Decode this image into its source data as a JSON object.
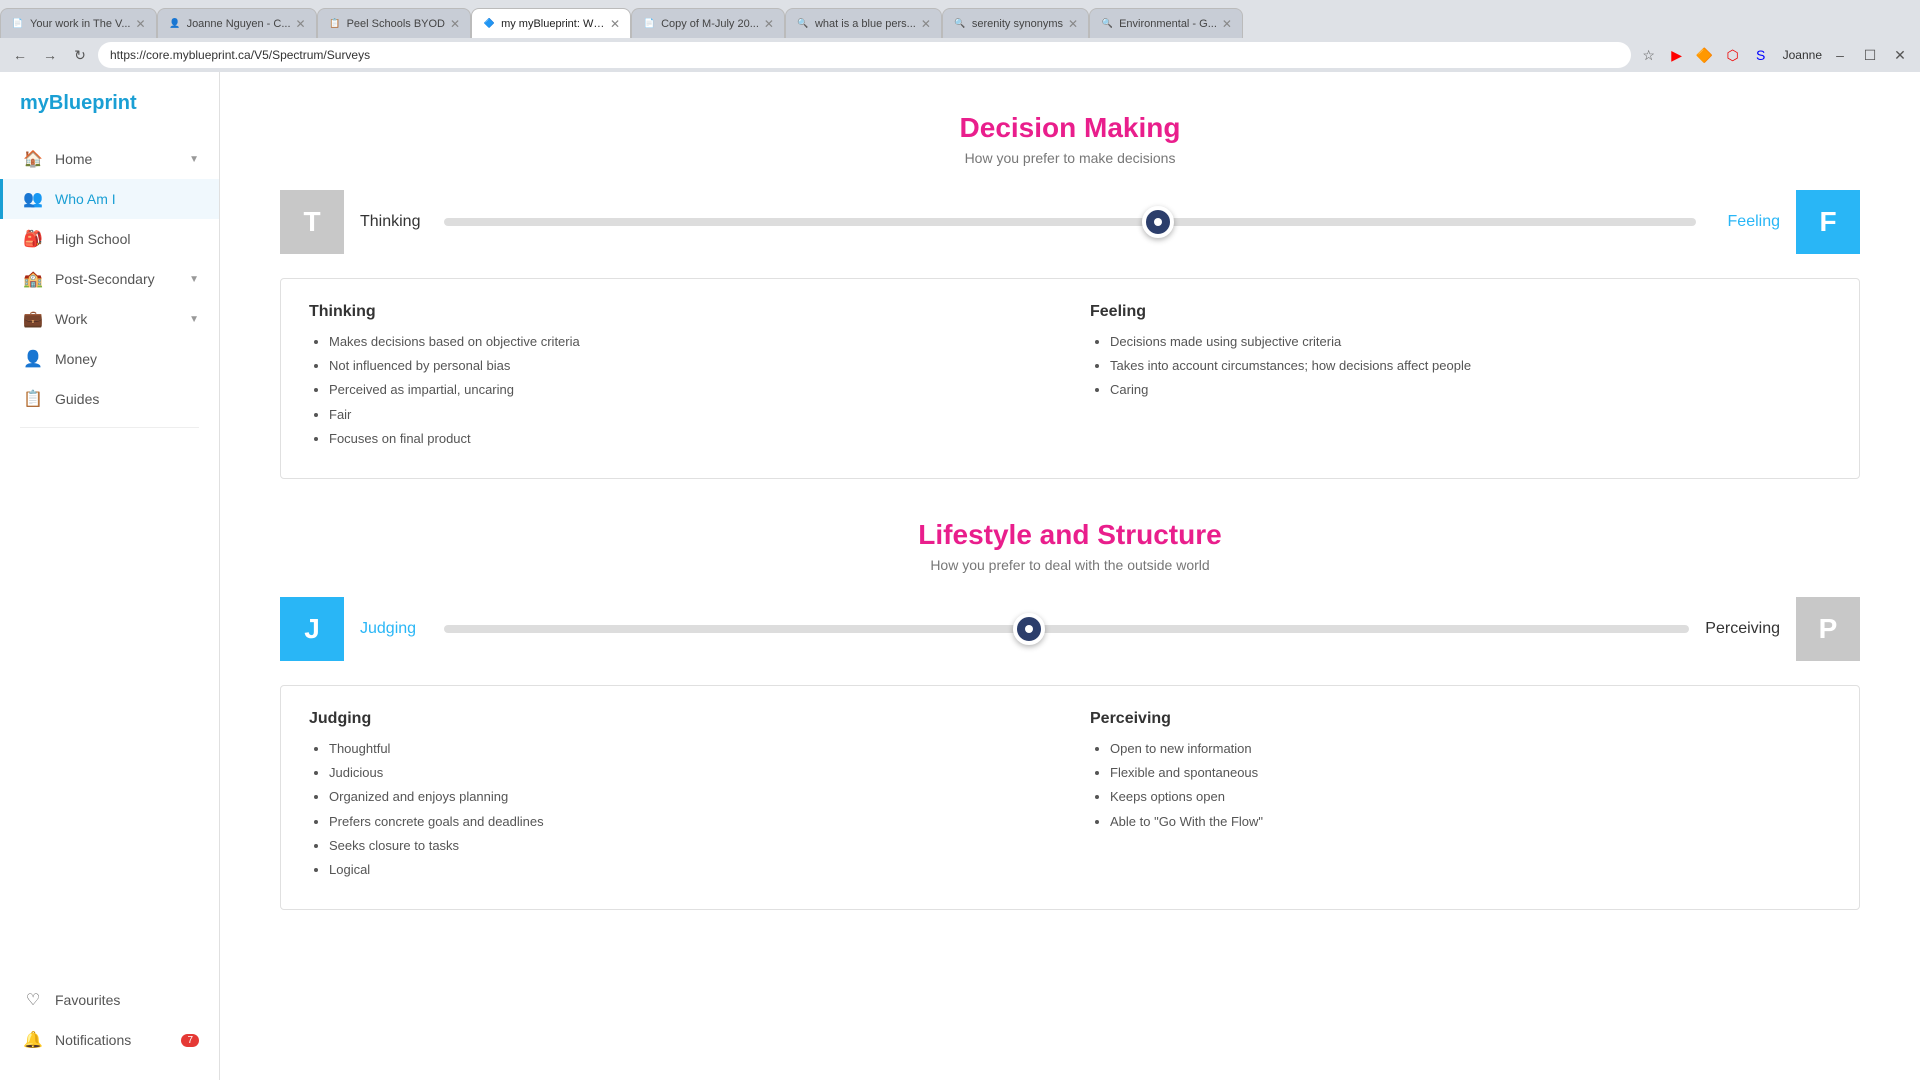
{
  "browser": {
    "url": "https://core.myblueprint.ca/V5/Spectrum/Surveys",
    "user": "Joanne",
    "tabs": [
      {
        "id": "tab1",
        "label": "Your work in The V...",
        "favicon": "📄",
        "active": false
      },
      {
        "id": "tab2",
        "label": "Joanne Nguyen - C...",
        "favicon": "👤",
        "active": false
      },
      {
        "id": "tab3",
        "label": "Peel Schools BYOD",
        "favicon": "📋",
        "active": false
      },
      {
        "id": "tab4",
        "label": "my myBlueprint: Who...",
        "favicon": "🔷",
        "active": true
      },
      {
        "id": "tab5",
        "label": "Copy of M-July 20...",
        "favicon": "📄",
        "active": false
      },
      {
        "id": "tab6",
        "label": "what is a blue pers...",
        "favicon": "🔍",
        "active": false
      },
      {
        "id": "tab7",
        "label": "serenity synonyms",
        "favicon": "🔍",
        "active": false
      },
      {
        "id": "tab8",
        "label": "Environmental - G...",
        "favicon": "🔍",
        "active": false
      }
    ]
  },
  "sidebar": {
    "logo": "myBlueprint",
    "nav_items": [
      {
        "id": "home",
        "label": "Home",
        "icon": "🏠",
        "has_arrow": true,
        "active": false
      },
      {
        "id": "who-am-i",
        "label": "Who Am I",
        "icon": "👥",
        "has_arrow": false,
        "active": true
      },
      {
        "id": "high-school",
        "label": "High School",
        "icon": "🎒",
        "has_arrow": false,
        "active": false
      },
      {
        "id": "post-secondary",
        "label": "Post-Secondary",
        "icon": "🏫",
        "has_arrow": true,
        "active": false
      },
      {
        "id": "work",
        "label": "Work",
        "icon": "💼",
        "has_arrow": true,
        "active": false
      },
      {
        "id": "money",
        "label": "Money",
        "icon": "👤",
        "has_arrow": false,
        "active": false
      },
      {
        "id": "guides",
        "label": "Guides",
        "icon": "📋",
        "has_arrow": false,
        "active": false
      }
    ],
    "bottom_items": [
      {
        "id": "favourites",
        "label": "Favourites",
        "icon": "♡",
        "badge": null
      },
      {
        "id": "notifications",
        "label": "Notifications",
        "icon": "🔔",
        "badge": "7"
      }
    ]
  },
  "main": {
    "decision_making": {
      "title": "Decision Making",
      "subtitle": "How you prefer to make decisions",
      "left_letter": "T",
      "left_label": "Thinking",
      "right_letter": "F",
      "right_label": "Feeling",
      "active_side": "right",
      "thumb_position_pct": 57,
      "thinking": {
        "heading": "Thinking",
        "items": [
          "Makes decisions based on objective criteria",
          "Not influenced by personal bias",
          "Perceived as impartial, uncaring",
          "Fair",
          "Focuses on final product"
        ]
      },
      "feeling": {
        "heading": "Feeling",
        "items": [
          "Decisions made using subjective criteria",
          "Takes into account circumstances; how decisions affect people",
          "Caring"
        ]
      }
    },
    "lifestyle": {
      "title": "Lifestyle and Structure",
      "subtitle": "How you prefer to deal with the outside world",
      "left_letter": "J",
      "left_label": "Judging",
      "right_letter": "P",
      "right_label": "Perceiving",
      "active_side": "left",
      "thumb_position_pct": 47,
      "judging": {
        "heading": "Judging",
        "items": [
          "Thoughtful",
          "Judicious",
          "Organized and enjoys planning",
          "Prefers concrete goals and deadlines",
          "Seeks closure to tasks",
          "Logical"
        ]
      },
      "perceiving": {
        "heading": "Perceiving",
        "items": [
          "Open to new information",
          "Flexible and spontaneous",
          "Keeps options open",
          "Able to \"Go With the Flow\""
        ]
      }
    }
  }
}
